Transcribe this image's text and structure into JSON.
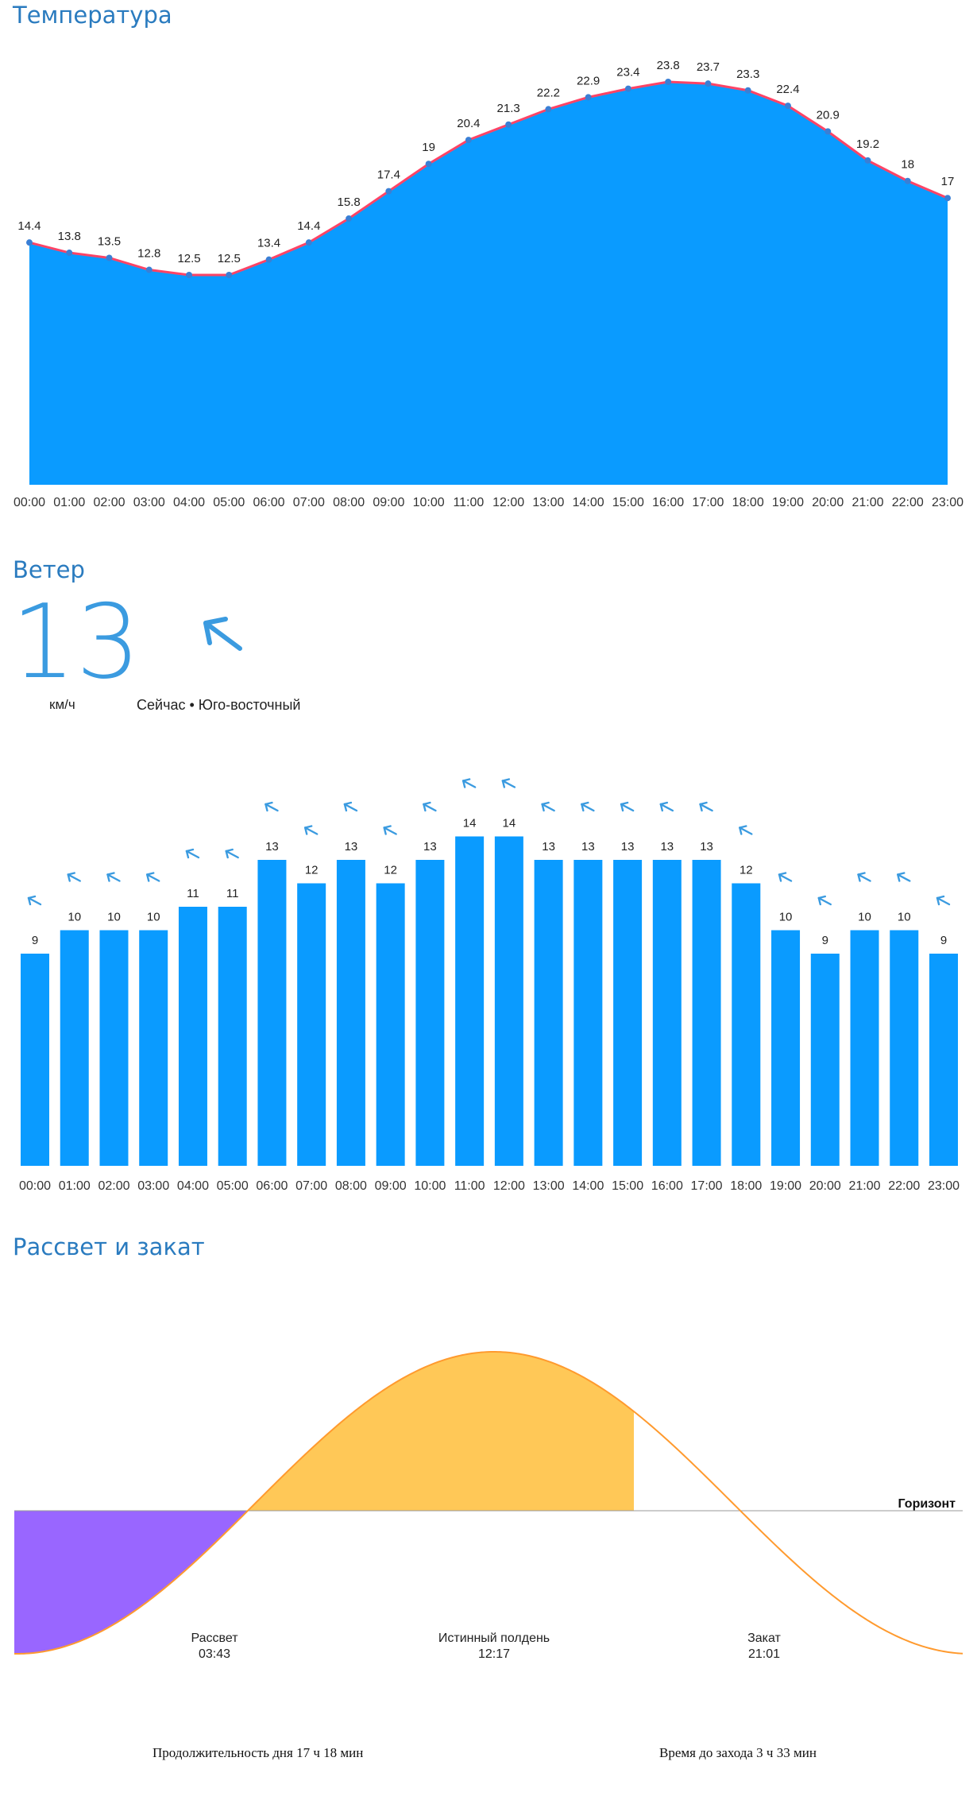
{
  "temperature": {
    "title": "Температура"
  },
  "wind": {
    "title": "Ветер",
    "current_speed": "13",
    "unit": "км/ч",
    "now_label": "Сейчас • Юго-восточный",
    "current_arrow_icon": "arrow-up-left-icon",
    "color": "#0a9bff",
    "arrow_color": "#3b9be0"
  },
  "sun": {
    "title": "Рассвет и закат",
    "horizon_label": "Горизонт",
    "sunrise_label": "Рассвет",
    "sunrise_time": "03:43",
    "noon_label": "Истинный полдень",
    "noon_time": "12:17",
    "sunset_label": "Закат",
    "sunset_time": "21:01",
    "day_length": "Продолжительность дня 17 ч 18 мин",
    "time_to_sunset": "Время до захода 3 ч 33 мин",
    "colors": {
      "night": "#9966ff",
      "day": "#ffc857",
      "curve": "#ff9a2e",
      "horizon": "#999999"
    }
  },
  "chart_data": [
    {
      "type": "area",
      "title": "Температура",
      "categories": [
        "00:00",
        "01:00",
        "02:00",
        "03:00",
        "04:00",
        "05:00",
        "06:00",
        "07:00",
        "08:00",
        "09:00",
        "10:00",
        "11:00",
        "12:00",
        "13:00",
        "14:00",
        "15:00",
        "16:00",
        "17:00",
        "18:00",
        "19:00",
        "20:00",
        "21:00",
        "22:00",
        "23:00"
      ],
      "values": [
        14.4,
        13.8,
        13.5,
        12.8,
        12.5,
        12.5,
        13.4,
        14.4,
        15.8,
        17.4,
        19,
        20.4,
        21.3,
        22.2,
        22.9,
        23.4,
        23.8,
        23.7,
        23.3,
        22.4,
        20.9,
        19.2,
        18,
        17
      ],
      "colors": {
        "fill": "#0a9bff",
        "line": "#ff4466",
        "point": "#3a7fd5"
      }
    },
    {
      "type": "bar",
      "title": "Ветер",
      "categories": [
        "00:00",
        "01:00",
        "02:00",
        "03:00",
        "04:00",
        "05:00",
        "06:00",
        "07:00",
        "08:00",
        "09:00",
        "10:00",
        "11:00",
        "12:00",
        "13:00",
        "14:00",
        "15:00",
        "16:00",
        "17:00",
        "18:00",
        "19:00",
        "20:00",
        "21:00",
        "22:00",
        "23:00"
      ],
      "values": [
        9,
        10,
        10,
        10,
        11,
        11,
        13,
        12,
        13,
        12,
        13,
        14,
        14,
        13,
        13,
        13,
        13,
        13,
        12,
        10,
        9,
        10,
        10,
        9
      ],
      "direction_icons": [
        "arrow-up-left-icon",
        "arrow-up-left-icon",
        "arrow-up-left-icon",
        "arrow-up-left-icon",
        "arrow-up-left-icon",
        "arrow-up-left-icon",
        "arrow-up-left-icon",
        "arrow-up-left-icon",
        "arrow-up-left-icon",
        "arrow-up-left-icon",
        "arrow-up-left-icon",
        "arrow-up-left-icon",
        "arrow-up-left-icon",
        "arrow-up-left-icon",
        "arrow-up-left-icon",
        "arrow-up-left-icon",
        "arrow-up-left-icon",
        "arrow-up-left-icon",
        "arrow-up-left-icon",
        "arrow-up-left-icon",
        "arrow-up-left-icon",
        "arrow-up-left-icon",
        "arrow-up-left-icon",
        "arrow-up-left-icon"
      ],
      "colors": {
        "bar": "#0a9bff"
      }
    }
  ]
}
